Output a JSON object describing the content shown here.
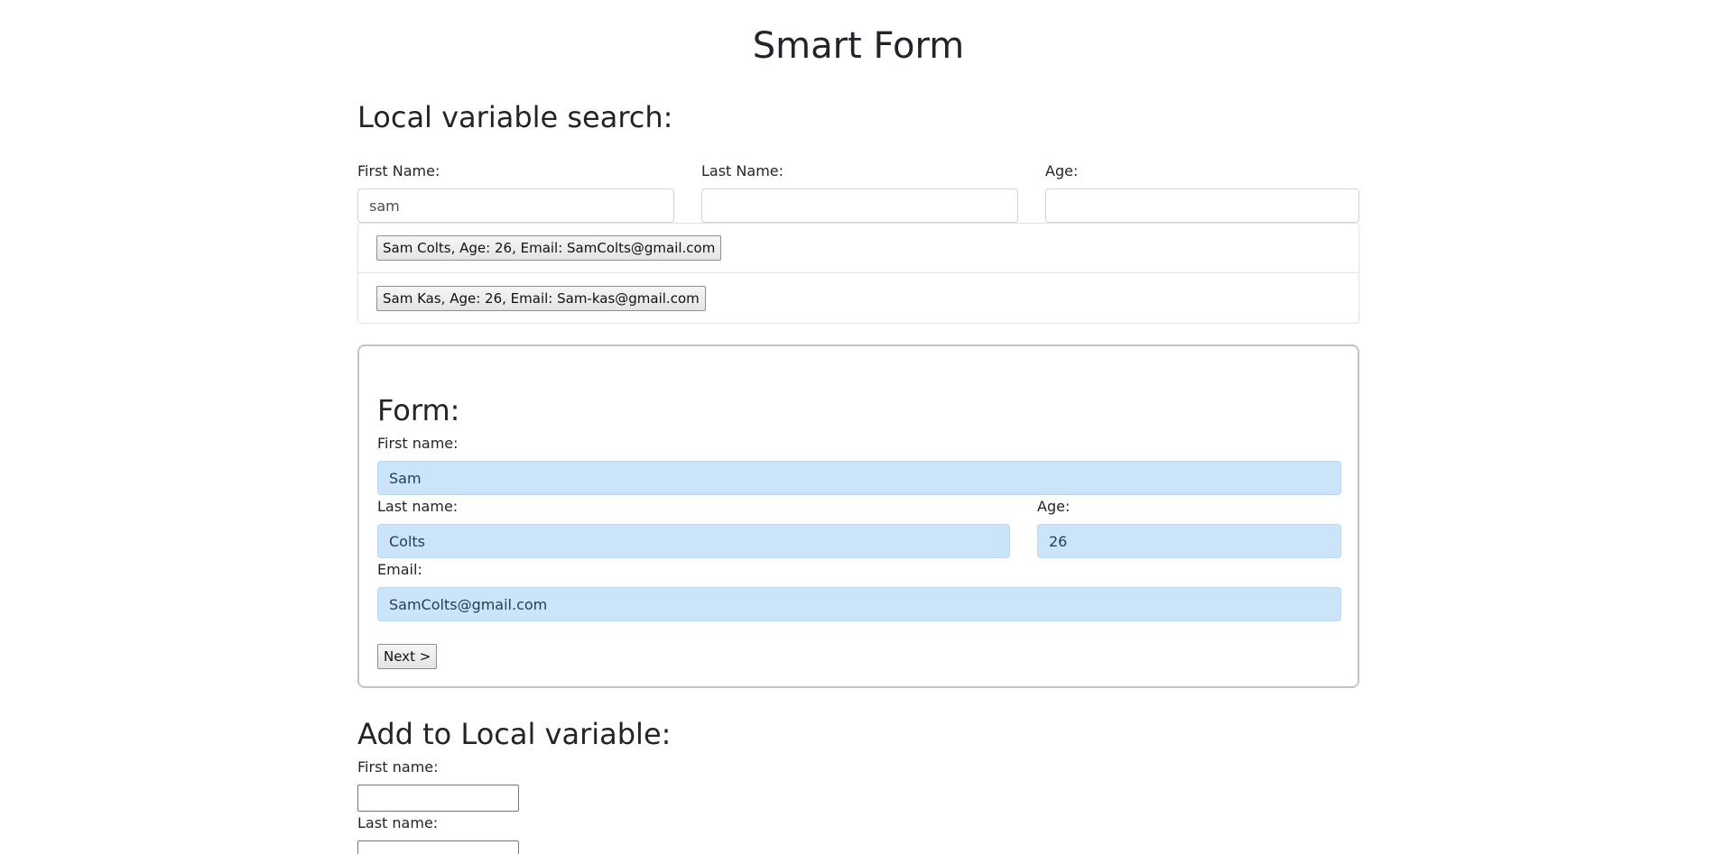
{
  "page": {
    "title": "Smart Form"
  },
  "search": {
    "heading": "Local variable search:",
    "first_name_label": "First Name:",
    "first_name_value": "sam",
    "last_name_label": "Last Name:",
    "last_name_value": "",
    "age_label": "Age:",
    "age_value": "",
    "results": [
      {
        "label": "Sam Colts, Age: 26, Email: SamColts@gmail.com"
      },
      {
        "label": "Sam Kas, Age: 26, Email: Sam-kas@gmail.com"
      }
    ]
  },
  "form": {
    "heading": "Form:",
    "first_name_label": "First name:",
    "first_name_value": "Sam",
    "last_name_label": "Last name:",
    "last_name_value": "Colts",
    "age_label": "Age:",
    "age_value": "26",
    "email_label": "Email:",
    "email_value": "SamColts@gmail.com",
    "next_button": "Next >"
  },
  "add": {
    "heading": "Add to Local variable:",
    "first_name_label": "First name:",
    "first_name_value": "",
    "last_name_label": "Last name:",
    "last_name_value": ""
  },
  "colors": {
    "filled_input_bg": "#cce4fa",
    "text": "#212529",
    "border": "#ced4da"
  }
}
